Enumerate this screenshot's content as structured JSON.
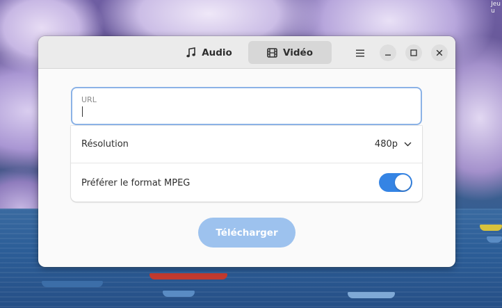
{
  "desktop": {
    "corner_text": "Jeu\nu"
  },
  "window": {
    "tabs": [
      {
        "label": "Audio",
        "icon": "music-note-icon",
        "active": false
      },
      {
        "label": "Vidéo",
        "icon": "film-icon",
        "active": true
      }
    ],
    "menu_icon": "hamburger-menu-icon",
    "window_controls": [
      "minimize-icon",
      "maximize-icon",
      "close-icon"
    ]
  },
  "form": {
    "url_label": "URL",
    "url_value": "",
    "resolution_label": "Résolution",
    "resolution_value": "480p",
    "mpeg_label": "Préférer le format MPEG",
    "mpeg_enabled": true,
    "download_label": "Télécharger"
  },
  "colors": {
    "accent": "#3584e4",
    "download_button_disabled": "#9dc2ee",
    "focus_border": "#8bb2e6",
    "headerbar": "#ebebeb"
  }
}
